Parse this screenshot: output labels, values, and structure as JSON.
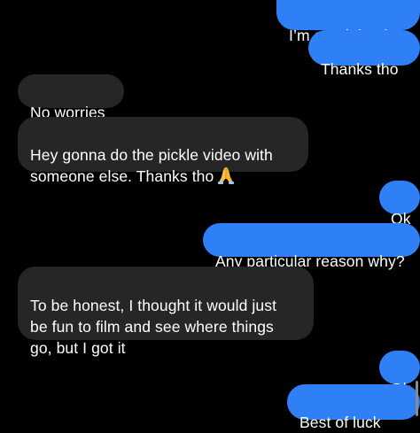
{
  "conversation": {
    "messages": [
      {
        "from": "me",
        "text": "I’m good thanks"
      },
      {
        "from": "me",
        "text": "Thanks tho"
      },
      {
        "from": "them",
        "text": "No worries"
      },
      {
        "from": "them",
        "text": "Hey gonna do the pickle video with\nsomeone else. Thanks tho",
        "emoji": "folded-hands"
      },
      {
        "from": "me",
        "text": "Ok"
      },
      {
        "from": "me",
        "text": "Any particular reason why?"
      },
      {
        "from": "them",
        "text": "To be honest, I thought it would just\nbe fun to film and see where things\ngo, but I got it"
      },
      {
        "from": "me",
        "text": "Ok"
      },
      {
        "from": "me",
        "text": "Best of luck"
      }
    ]
  },
  "colors": {
    "background": "#000000",
    "sent_bubble": "#2f80f6",
    "received_bubble": "#262629",
    "text": "#ffffff"
  }
}
